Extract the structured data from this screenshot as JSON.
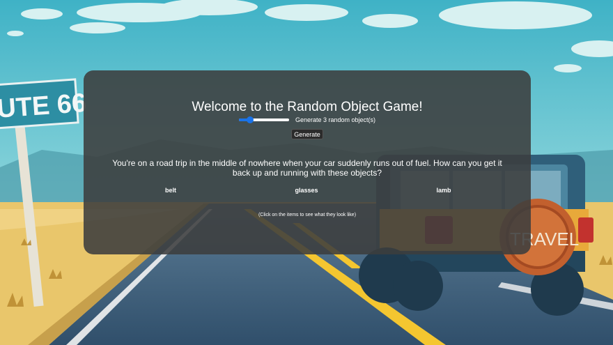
{
  "sign": {
    "text": "UTE 66"
  },
  "spare_tire": {
    "text": "TRAVEL"
  },
  "game": {
    "title": "Welcome to the Random Object Game!",
    "slider": {
      "value": 3,
      "min": 1,
      "max": 10,
      "label": "Generate 3 random object(s)"
    },
    "generate_label": "Generate",
    "prompt": "You're on a road trip in the middle of nowhere when your car suddenly runs out of fuel. How can you get it back up and running with these objects?",
    "objects": [
      "belt",
      "glasses",
      "lamb"
    ],
    "hint": "(Click on the items to see what they look like)"
  },
  "colors": {
    "accent": "#1a73e8",
    "panel": "#3c3e3e",
    "sky": "#5fb9c9",
    "road": "#3a5f7e",
    "desert": "#e9c66b"
  }
}
